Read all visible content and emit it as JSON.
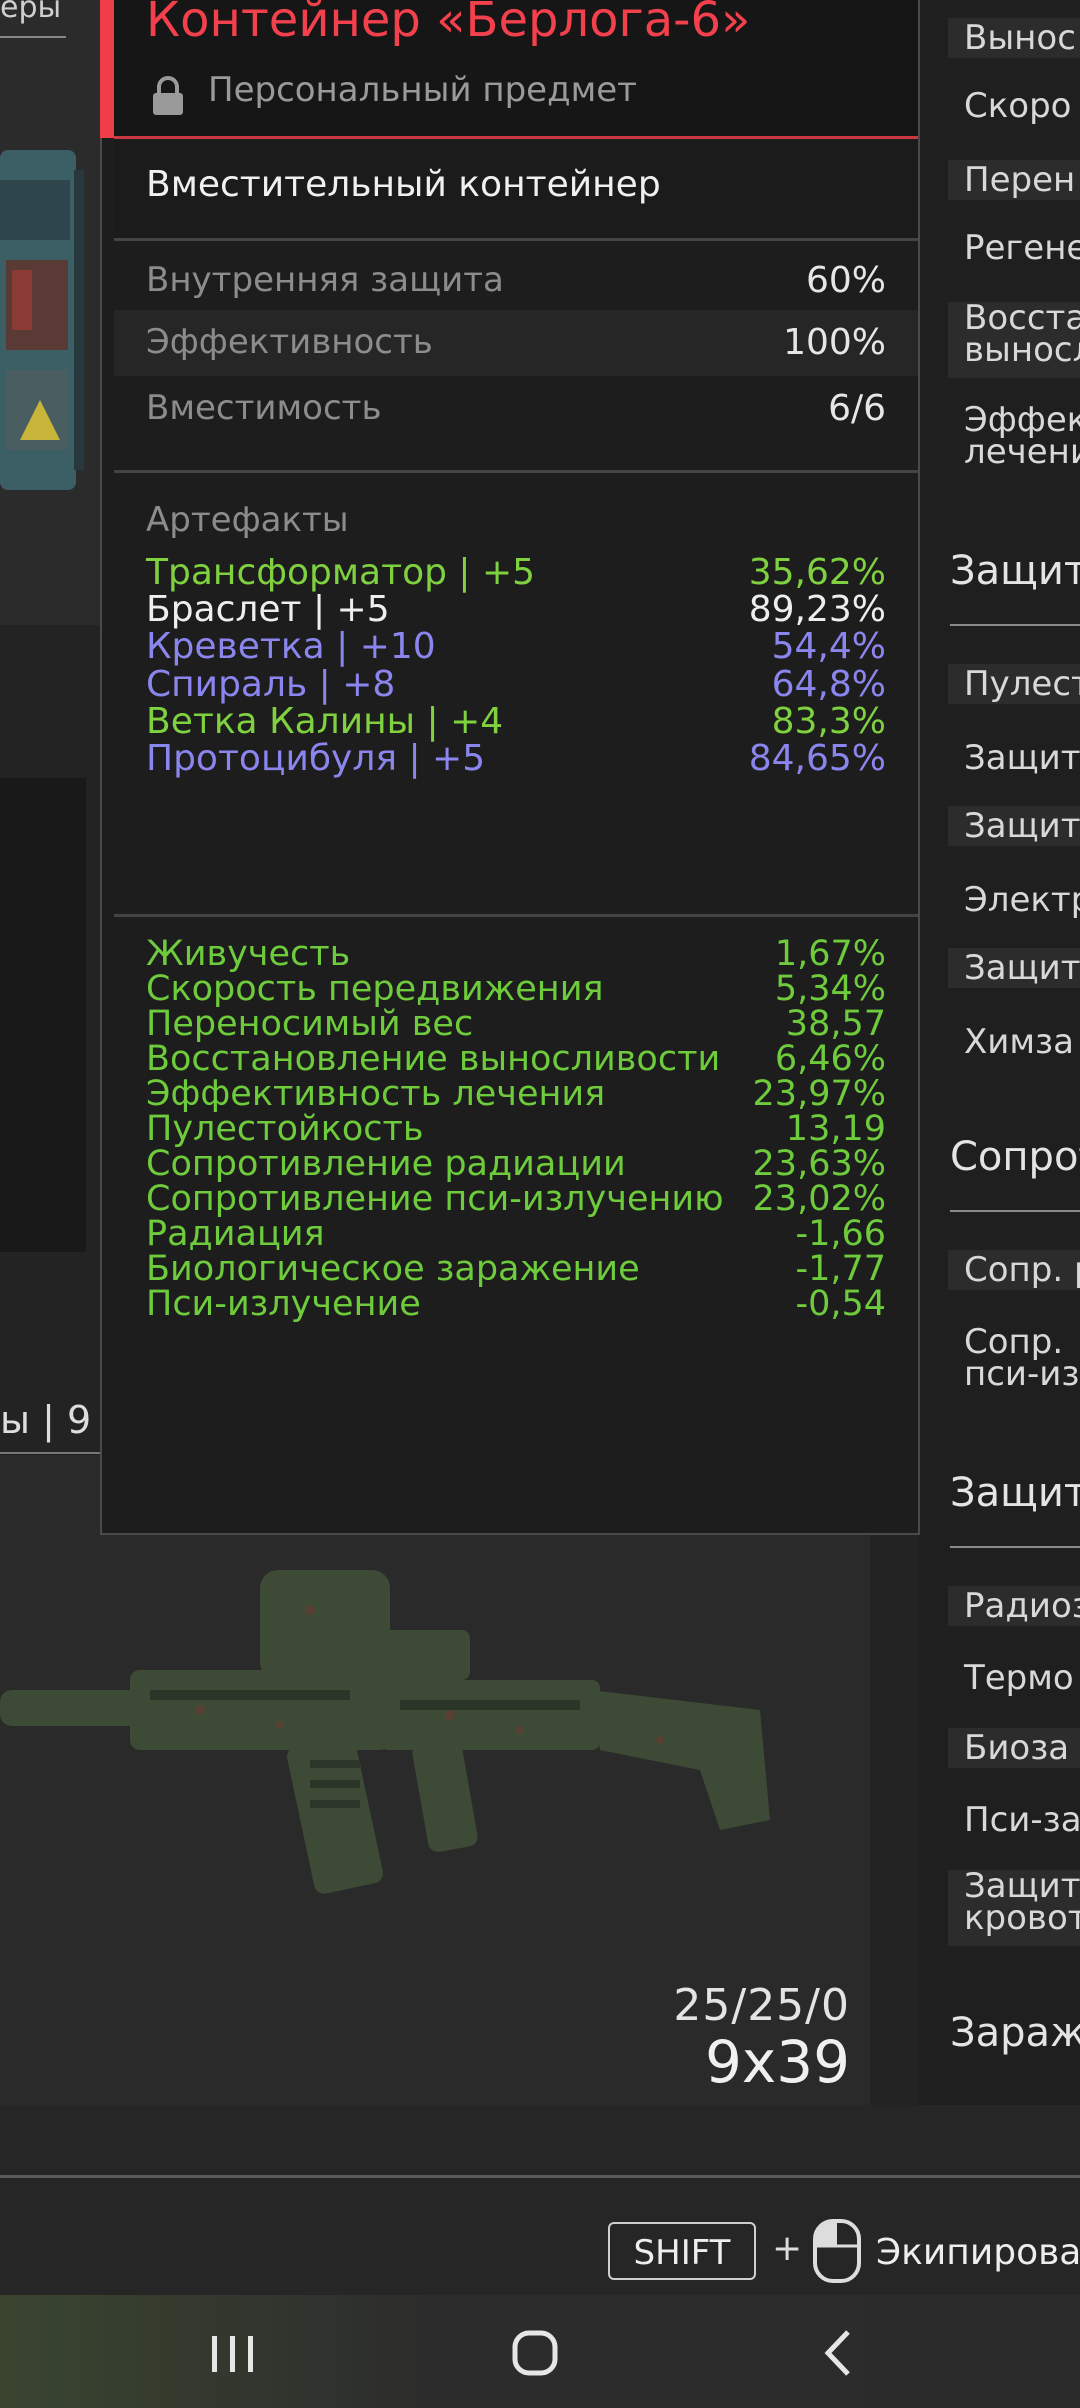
{
  "left": {
    "top_label": "еры",
    "mid_label": "ы | 9"
  },
  "weapon": {
    "ammo": "25/25/0",
    "caliber": "9x39"
  },
  "tooltip": {
    "title": "Контейнер «Берлога-6»",
    "subtitle": "Персональный предмет",
    "type": "Вместительный контейнер",
    "stats": [
      {
        "label": "Внутренняя защита",
        "value": "60%"
      },
      {
        "label": "Эффективность",
        "value": "100%"
      },
      {
        "label": "Вместимость",
        "value": "6/6"
      }
    ],
    "artifacts_title": "Артефакты",
    "artifacts": [
      {
        "name": "Трансформатор | +5",
        "value": "35,62%",
        "color": "#7fd13f"
      },
      {
        "name": "Браслет | +5",
        "value": "89,23%",
        "color": "#eeeeee"
      },
      {
        "name": "Креветка | +10",
        "value": "54,4%",
        "color": "#8a86ee"
      },
      {
        "name": "Спираль | +8",
        "value": "64,8%",
        "color": "#8a86ee"
      },
      {
        "name": "Ветка Калины | +4",
        "value": "83,3%",
        "color": "#7fd13f"
      },
      {
        "name": "Протоцибуля | +5",
        "value": "84,65%",
        "color": "#8a86ee"
      }
    ],
    "effects": [
      {
        "name": "Живучесть",
        "value": "1,67%"
      },
      {
        "name": "Скорость передвижения",
        "value": "5,34%"
      },
      {
        "name": "Переносимый вес",
        "value": "38,57"
      },
      {
        "name": "Восстановление выносливости",
        "value": "6,46%"
      },
      {
        "name": "Эффективность лечения",
        "value": "23,97%"
      },
      {
        "name": "Пулестойкость",
        "value": "13,19"
      },
      {
        "name": "Сопротивление радиации",
        "value": "23,63%"
      },
      {
        "name": "Сопротивление пси-излучению",
        "value": "23,02%"
      },
      {
        "name": "Радиация",
        "value": "-1,66"
      },
      {
        "name": "Биологическое заражение",
        "value": "-1,77"
      },
      {
        "name": "Пси-излучение",
        "value": "-0,54"
      }
    ]
  },
  "right": {
    "rows_top": [
      "Вынос",
      "Скоро",
      "Перен",
      "Регене"
    ],
    "row_two_a": [
      "Восста",
      "выносл"
    ],
    "row_two_b": [
      "Эффек",
      "лечени"
    ],
    "section1": "Защит",
    "rows_s1": [
      "Пулест",
      "Защит",
      "Защит",
      "Электр",
      "Защит",
      "Химза"
    ],
    "section2": "Сопрот",
    "rows_s2_a": "Сопр. р",
    "rows_s2_b": [
      "Сопр.",
      "пси-из"
    ],
    "section3": "Защит",
    "rows_s3": [
      "Радиоз",
      "Термо",
      "Биоза",
      "Пси-за"
    ],
    "row_s3_two": [
      "Защит",
      "кровот"
    ],
    "section4": "Зараж"
  },
  "footer": {
    "shift_key": "SHIFT",
    "plus": "+",
    "equip_label": "Экипироват"
  },
  "colors": {
    "accent_red": "#ef3d4a",
    "green": "#7fd13f",
    "blue": "#8a86ee"
  }
}
